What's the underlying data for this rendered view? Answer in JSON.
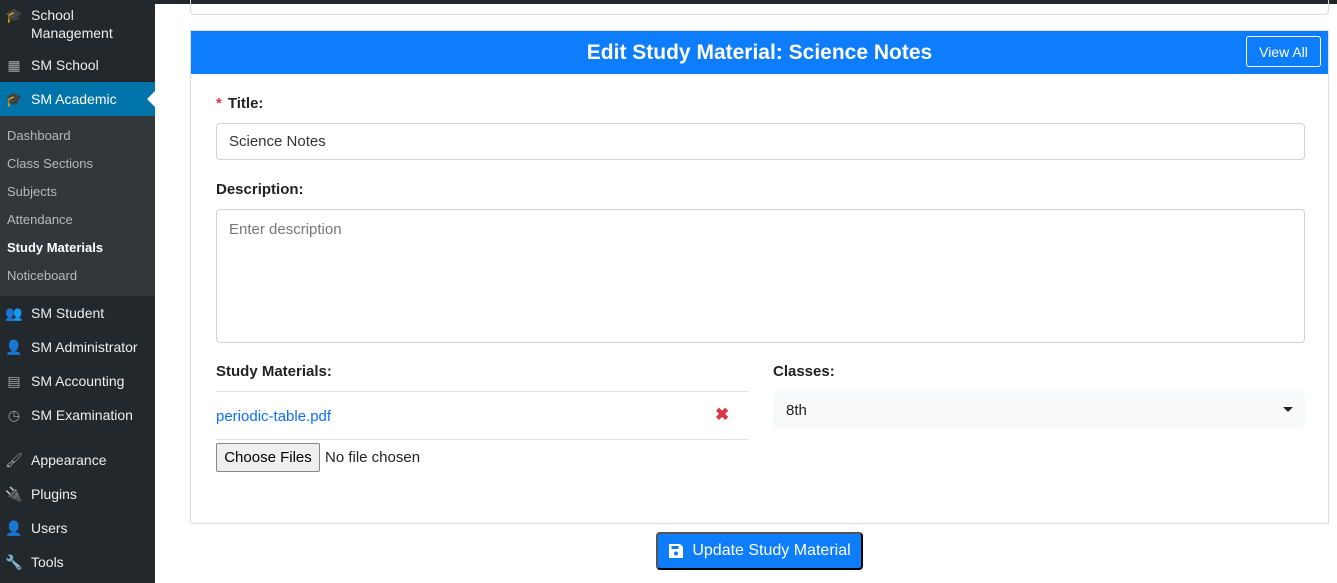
{
  "sidebar": {
    "top_items": [
      {
        "label": "School Management",
        "icon": "graduation-cap-icon"
      },
      {
        "label": "SM School",
        "icon": "building-icon"
      },
      {
        "label": "SM Academic",
        "icon": "graduation-cap-icon"
      }
    ],
    "submenu": [
      "Dashboard",
      "Class Sections",
      "Subjects",
      "Attendance",
      "Study Materials",
      "Noticeboard"
    ],
    "items": [
      {
        "label": "SM Student",
        "icon": "users-icon"
      },
      {
        "label": "SM Administrator",
        "icon": "user-tie-icon"
      },
      {
        "label": "SM Accounting",
        "icon": "ledger-icon"
      },
      {
        "label": "SM Examination",
        "icon": "clock-icon"
      }
    ],
    "wp_items": [
      {
        "label": "Appearance",
        "icon": "paintbrush-icon"
      },
      {
        "label": "Plugins",
        "icon": "plug-icon"
      },
      {
        "label": "Users",
        "icon": "user-icon"
      },
      {
        "label": "Tools",
        "icon": "wrench-icon"
      }
    ]
  },
  "form": {
    "heading": "Edit Study Material: Science Notes",
    "view_all": "View All",
    "required_mark": "*",
    "title_label": "Title:",
    "title_value": "Science Notes",
    "description_label": "Description:",
    "description_placeholder": "Enter description",
    "materials_label": "Study Materials:",
    "file_name": "periodic-table.pdf",
    "remove_icon": "✖",
    "choose_files": "Choose Files",
    "no_file": "No file chosen",
    "classes_label": "Classes:",
    "classes_value": "8th",
    "submit": "Update Study Material"
  },
  "colors": {
    "accent": "#0d7dfc",
    "sidebar": "#23282d",
    "active": "#0073aa",
    "danger": "#dc3545"
  }
}
